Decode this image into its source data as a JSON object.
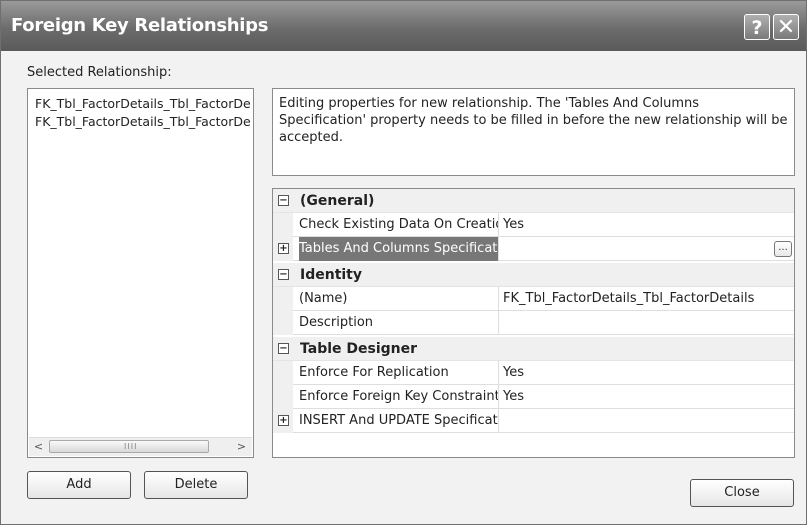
{
  "window": {
    "title": "Foreign Key Relationships",
    "help_glyph": "?",
    "close_glyph": "✕"
  },
  "selected_label": "Selected Relationship:",
  "relationships": [
    "FK_Tbl_FactorDetails_Tbl_FactorDetails",
    "FK_Tbl_FactorDetails_Tbl_FactorDetails"
  ],
  "scrollbar": {
    "left": "<",
    "right": ">",
    "grip": "IIII"
  },
  "buttons": {
    "add": "Add",
    "delete": "Delete",
    "close": "Close"
  },
  "description": "Editing properties for new relationship.  The 'Tables And Columns Specification' property needs to be filled in before the new relationship will be accepted.",
  "properties": {
    "collapse_glyph": "−",
    "expand_glyph": "+",
    "ellipsis_glyph": "...",
    "general": {
      "label": "(General)",
      "check_existing": {
        "name": "Check Existing Data On Creation Or Re-Enabling",
        "value": "Yes"
      },
      "tables_columns": {
        "name": "Tables And Columns Specification",
        "value": ""
      }
    },
    "identity": {
      "label": "Identity",
      "name_row": {
        "name": "(Name)",
        "value": "FK_Tbl_FactorDetails_Tbl_FactorDetails"
      },
      "description_row": {
        "name": "Description",
        "value": ""
      }
    },
    "table_designer": {
      "label": "Table Designer",
      "enforce_replication": {
        "name": "Enforce For Replication",
        "value": "Yes"
      },
      "enforce_fk": {
        "name": "Enforce Foreign Key Constraint",
        "value": "Yes"
      },
      "insert_update": {
        "name": "INSERT And UPDATE Specification",
        "value": ""
      }
    }
  }
}
